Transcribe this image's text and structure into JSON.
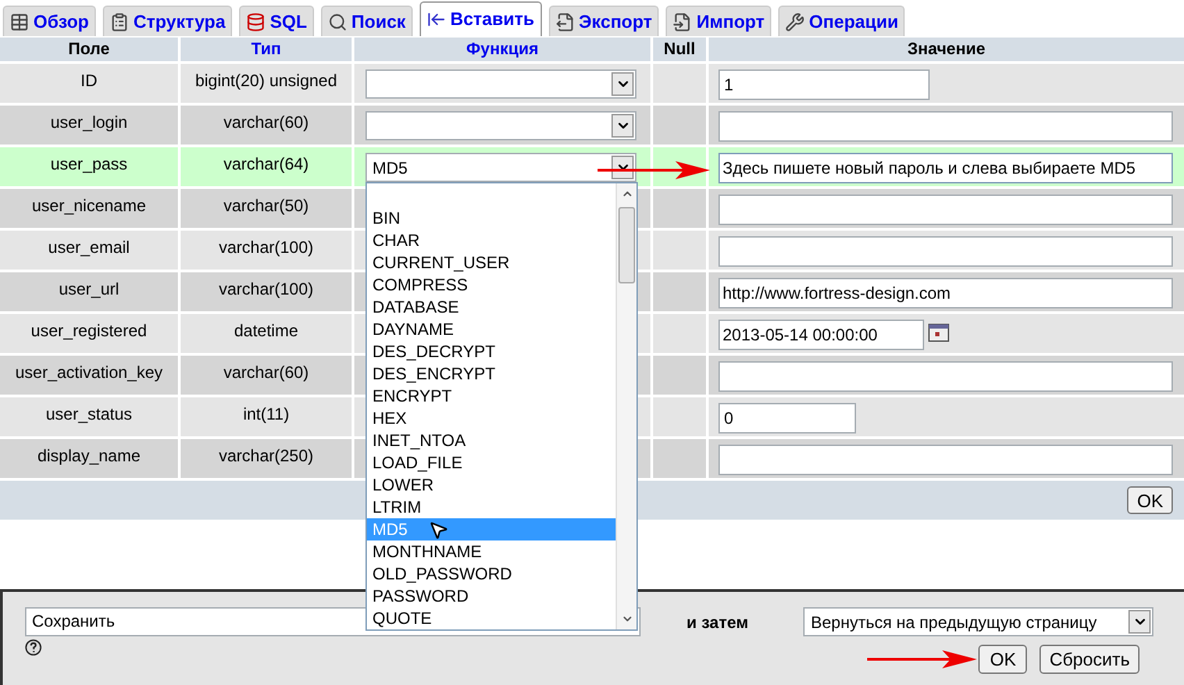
{
  "tabs": [
    {
      "label": "Обзор",
      "selected": false
    },
    {
      "label": "Структура",
      "selected": false
    },
    {
      "label": "SQL",
      "selected": false
    },
    {
      "label": "Поиск",
      "selected": false
    },
    {
      "label": "Вставить",
      "selected": true
    },
    {
      "label": "Экспорт",
      "selected": false
    },
    {
      "label": "Импорт",
      "selected": false
    },
    {
      "label": "Операции",
      "selected": false
    }
  ],
  "table": {
    "columns": [
      "Поле",
      "Тип",
      "Функция",
      "Null",
      "Значение"
    ],
    "rows": [
      {
        "field": "ID",
        "type": "bigint(20) unsigned",
        "highlighted": false,
        "function_select": true,
        "kind": "short",
        "value": "1"
      },
      {
        "field": "user_login",
        "type": "varchar(60)",
        "highlighted": false,
        "function_select": true,
        "kind": "text"
      },
      {
        "field": "user_pass",
        "type": "varchar(64)",
        "highlighted": true,
        "function_select": true,
        "function": "MD5",
        "kind": "text",
        "value": "Здесь пишете новый пароль и слева выбираете MD5"
      },
      {
        "field": "user_nicename",
        "type": "varchar(50)",
        "highlighted": false,
        "function_select": false,
        "kind": "text"
      },
      {
        "field": "user_email",
        "type": "varchar(100)",
        "highlighted": false,
        "function_select": false,
        "kind": "text"
      },
      {
        "field": "user_url",
        "type": "varchar(100)",
        "highlighted": false,
        "function_select": false,
        "kind": "text",
        "value": "http://www.fortress-design.com"
      },
      {
        "field": "user_registered",
        "type": "datetime",
        "highlighted": false,
        "function_select": false,
        "kind": "datetime",
        "value": "2013-05-14 00:00:00"
      },
      {
        "field": "user_activation_key",
        "type": "varchar(60)",
        "highlighted": false,
        "function_select": false,
        "kind": "text"
      },
      {
        "field": "user_status",
        "type": "int(11)",
        "highlighted": false,
        "function_select": false,
        "kind": "short",
        "value": "0"
      },
      {
        "field": "display_name",
        "type": "varchar(250)",
        "highlighted": false,
        "function_select": false,
        "kind": "text"
      }
    ],
    "ok_button": "OK"
  },
  "function_dropdown": {
    "options": [
      {
        "label": "BIN",
        "selected": false
      },
      {
        "label": "CHAR",
        "selected": false
      },
      {
        "label": "CURRENT_USER",
        "selected": false
      },
      {
        "label": "COMPRESS",
        "selected": false
      },
      {
        "label": "DATABASE",
        "selected": false
      },
      {
        "label": "DAYNAME",
        "selected": false
      },
      {
        "label": "DES_DECRYPT",
        "selected": false
      },
      {
        "label": "DES_ENCRYPT",
        "selected": false
      },
      {
        "label": "ENCRYPT",
        "selected": false
      },
      {
        "label": "HEX",
        "selected": false
      },
      {
        "label": "INET_NTOA",
        "selected": false
      },
      {
        "label": "LOAD_FILE",
        "selected": false
      },
      {
        "label": "LOWER",
        "selected": false
      },
      {
        "label": "LTRIM",
        "selected": false
      },
      {
        "label": "MD5",
        "selected": true
      },
      {
        "label": "MONTHNAME",
        "selected": false
      },
      {
        "label": "OLD_PASSWORD",
        "selected": false
      },
      {
        "label": "PASSWORD",
        "selected": false
      },
      {
        "label": "QUOTE",
        "selected": false
      }
    ]
  },
  "footer": {
    "action": "Сохранить",
    "then_label": "и затем",
    "after": "Вернуться на предыдущую страницу",
    "ok": "OK",
    "reset": "Сбросить"
  }
}
